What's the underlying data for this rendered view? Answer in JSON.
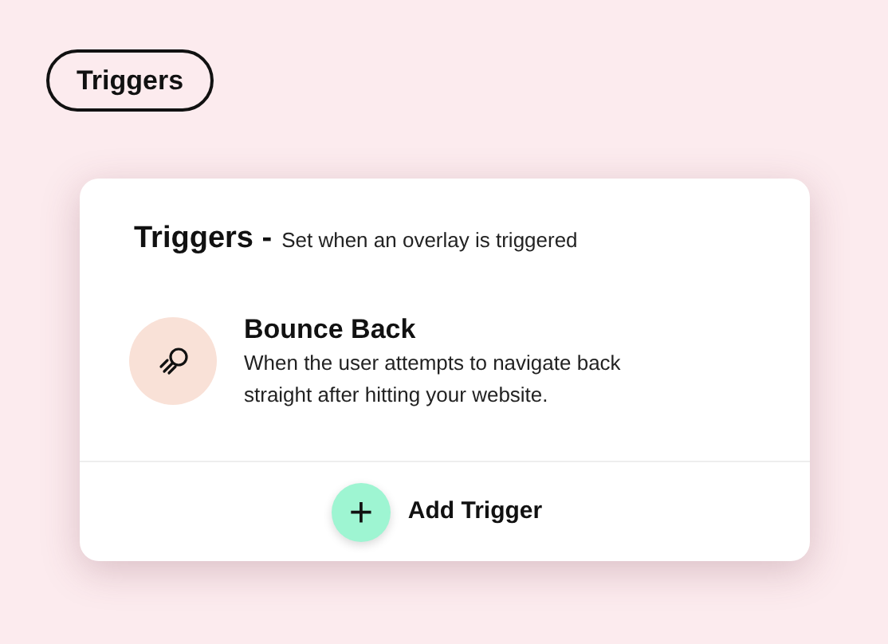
{
  "header": {
    "pill_label": "Triggers"
  },
  "card": {
    "title": "Triggers -",
    "subtitle": "Set when an overlay is triggered",
    "triggers": [
      {
        "kind": "bounce",
        "name": "Bounce Back",
        "description": "When the user attempts to navigate back straight after hitting your website."
      }
    ],
    "add_button": {
      "icon": "+",
      "label": "Add Trigger"
    }
  }
}
